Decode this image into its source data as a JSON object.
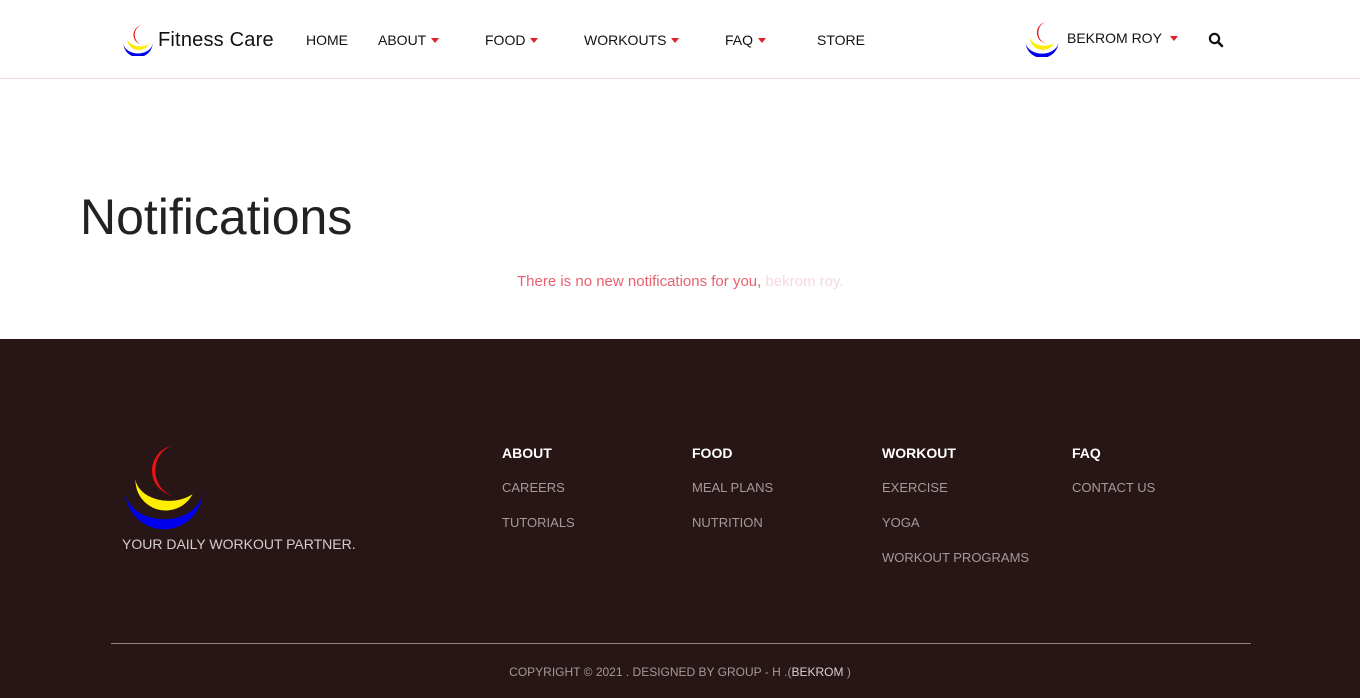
{
  "brand": {
    "name": "Fitness Care",
    "logo_icon": "crescent-logo-icon"
  },
  "nav": {
    "items": [
      {
        "label": "HOME",
        "dropdown": false
      },
      {
        "label": "ABOUT",
        "dropdown": true
      },
      {
        "label": "FOOD",
        "dropdown": true
      },
      {
        "label": "WORKOUTS",
        "dropdown": true
      },
      {
        "label": "FAQ",
        "dropdown": true
      },
      {
        "label": "STORE",
        "dropdown": false
      }
    ],
    "user_name": "BEKROM ROY",
    "search_icon": "search-icon"
  },
  "main": {
    "title": "Notifications",
    "message_prefix": "There is no new notifications for you,",
    "message_user": "bekrom roy."
  },
  "footer": {
    "tagline": "YOUR DAILY WORKOUT PARTNER.",
    "columns": [
      {
        "heading": "ABOUT",
        "links": [
          "CAREERS",
          "TUTORIALS"
        ]
      },
      {
        "heading": "FOOD",
        "links": [
          "MEAL PLANS",
          "NUTRITION"
        ]
      },
      {
        "heading": "WORKOUT",
        "links": [
          "EXERCISE",
          "YOGA",
          "WORKOUT PROGRAMS"
        ]
      },
      {
        "heading": "FAQ",
        "links": [
          "CONTACT US"
        ]
      }
    ],
    "copyright_prefix": "COPYRIGHT",
    "copyright_symbol": "©",
    "copyright_text": "2021 . DESIGNED BY GROUP - H .(",
    "copyright_author": "BEKROM",
    "copyright_suffix": ")"
  },
  "colors": {
    "accent_red": "#e0212c",
    "logo_red": "#ee1111",
    "logo_yellow": "#ffee00",
    "logo_blue": "#0000ee",
    "message_pink": "#e8606f",
    "footer_bg": "#281616"
  }
}
